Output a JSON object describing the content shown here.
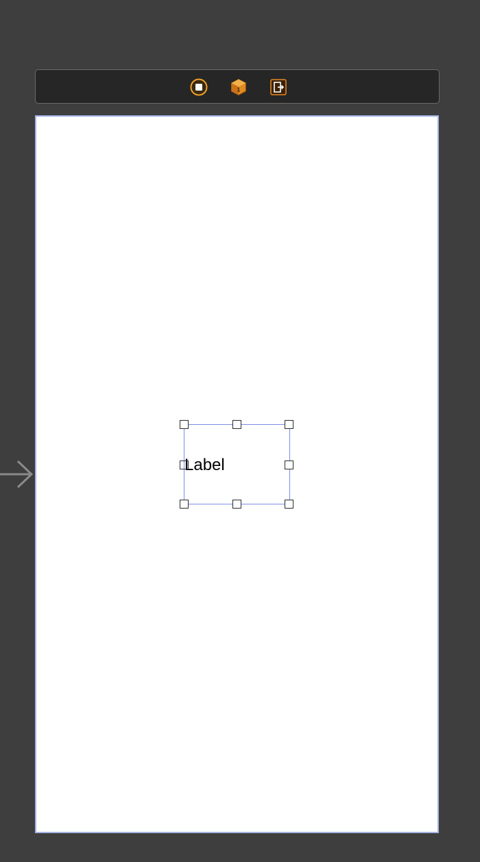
{
  "scene_dock": {
    "icons": [
      "view-controller-icon",
      "first-responder-icon",
      "exit-icon"
    ],
    "accent_color": "#f0a02a"
  },
  "view": {
    "background": "#ffffff",
    "border_color": "#a6b3e6"
  },
  "label": {
    "text": "Label",
    "selected": true,
    "selection_color": "#7b8de8"
  },
  "entry_point": {
    "icon": "entry-arrow-icon"
  }
}
